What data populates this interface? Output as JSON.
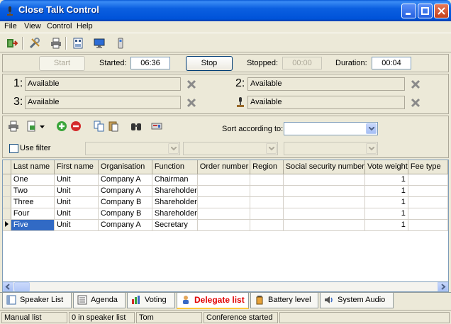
{
  "window": {
    "title": "Close Talk Control"
  },
  "menu": {
    "file": "File",
    "view": "View",
    "control": "Control",
    "help": "Help"
  },
  "controls": {
    "start_label": "Start",
    "started_label": "Started:",
    "started_value": "06:36",
    "stop_label": "Stop",
    "stopped_label": "Stopped:",
    "stopped_value": "00:00",
    "duration_label": "Duration:",
    "duration_value": "00:04"
  },
  "mics": [
    {
      "num": "1:",
      "value": "Available"
    },
    {
      "num": "2:",
      "value": "Available"
    },
    {
      "num": "3:",
      "value": "Available"
    },
    {
      "num": "",
      "value": "Available"
    }
  ],
  "filter": {
    "sort_label": "Sort according to:",
    "use_filter_label": "Use filter",
    "use_filter_checked": false
  },
  "table": {
    "columns": [
      "Last name",
      "First name",
      "Organisation",
      "Function",
      "Order number",
      "Region",
      "Social security number",
      "Vote weight",
      "Fee type"
    ],
    "rows": [
      [
        "One",
        "Unit",
        "Company A",
        "Chairman",
        "",
        "",
        "",
        "1",
        ""
      ],
      [
        "Two",
        "Unit",
        "Company A",
        "Shareholder",
        "",
        "",
        "",
        "1",
        ""
      ],
      [
        "Three",
        "Unit",
        "Company B",
        "Shareholder",
        "",
        "",
        "",
        "1",
        ""
      ],
      [
        "Four",
        "Unit",
        "Company B",
        "Shareholder",
        "",
        "",
        "",
        "1",
        ""
      ],
      [
        "Five",
        "Unit",
        "Company A",
        "Secretary",
        "",
        "",
        "",
        "1",
        ""
      ]
    ],
    "selected_row": 4
  },
  "tabs": [
    {
      "label": "Speaker List",
      "icon": "speaker-list-icon"
    },
    {
      "label": "Agenda",
      "icon": "agenda-icon"
    },
    {
      "label": "Voting",
      "icon": "voting-icon"
    },
    {
      "label": "Delegate list",
      "icon": "delegate-icon",
      "active": true
    },
    {
      "label": "Battery level",
      "icon": "battery-icon"
    },
    {
      "label": "System Audio",
      "icon": "audio-icon"
    }
  ],
  "status": {
    "mode": "Manual list",
    "speakers": "0 in speaker list",
    "user": "Tom",
    "conference": "Conference started"
  }
}
